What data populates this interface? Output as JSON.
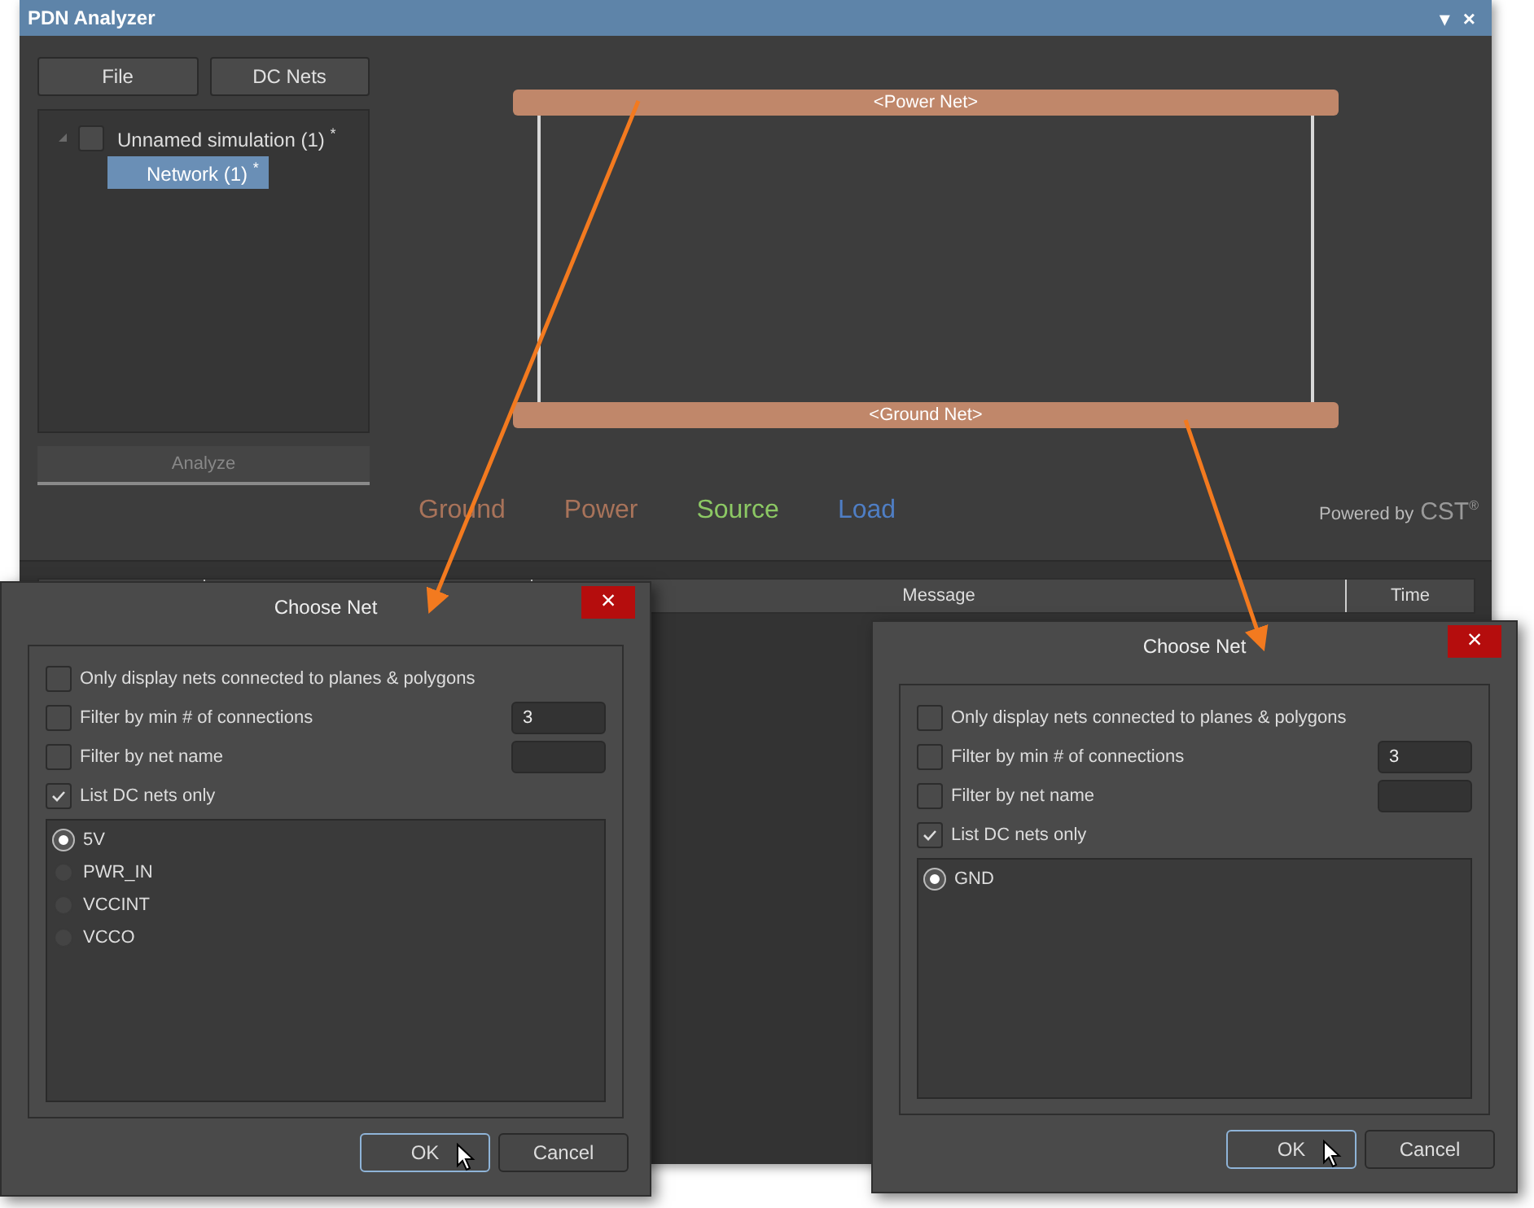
{
  "window": {
    "title": "PDN Analyzer",
    "menu_glyph": "▾",
    "close_glyph": "×"
  },
  "toolbar_buttons": [
    "File",
    "DC Nets"
  ],
  "tree": [
    {
      "label": "Unnamed simulation (1) $^{*}$",
      "checked": false,
      "expanded": true,
      "selected": false,
      "children": [
        {
          "label": "Network (1) $^{*}$",
          "selected": true
        }
      ]
    }
  ],
  "analyze_button": {
    "label": "Analyze",
    "disabled": true
  },
  "diagram": {
    "power_net": "<Power Net>",
    "ground_net": "<Ground Net>"
  },
  "legend": [
    {
      "label": "Ground",
      "color": "#a8735a"
    },
    {
      "label": "Power",
      "color": "#a8735a"
    },
    {
      "label": "Source",
      "color": "#8cc864"
    },
    {
      "label": "Load",
      "color": "#4f7ec4"
    }
  ],
  "brand": {
    "prefix": "Powered by",
    "name": "CST",
    "mark": "®"
  },
  "messages_table": {
    "columns": [
      "Message",
      "Time"
    ]
  },
  "dialogs": [
    {
      "title": "Choose Net",
      "close": "×",
      "options": [
        {
          "label": "Only display nets connected to planes & polygons",
          "checked": false,
          "kind": "plain"
        },
        {
          "label": "Filter by min # of connections",
          "checked": false,
          "kind": "field",
          "value": "3"
        },
        {
          "label": "Filter by net name",
          "checked": false,
          "kind": "field"
        },
        {
          "label": "List DC nets only",
          "checked": true,
          "kind": "plain"
        }
      ],
      "nets": [
        {
          "label": "5V",
          "selected": true
        },
        {
          "label": "PWR_IN",
          "selected": false
        },
        {
          "label": "VCCINT",
          "selected": false
        },
        {
          "label": "VCCO",
          "selected": false
        }
      ],
      "buttons": [
        {
          "label": "OK",
          "focused": true,
          "cursor": true
        },
        {
          "label": "Cancel",
          "focused": false,
          "cursor": false
        }
      ]
    },
    {
      "title": "Choose Net",
      "close": "×",
      "options": [
        {
          "label": "Only display nets connected to planes & polygons",
          "checked": false,
          "kind": "plain"
        },
        {
          "label": "Filter by min # of connections",
          "checked": false,
          "kind": "field",
          "value": "3"
        },
        {
          "label": "Filter by net name",
          "checked": false,
          "kind": "field"
        },
        {
          "label": "List DC nets only",
          "checked": true,
          "kind": "plain"
        }
      ],
      "nets": [
        {
          "label": "GND",
          "selected": true
        }
      ],
      "buttons": [
        {
          "label": "OK",
          "focused": true,
          "cursor": true
        },
        {
          "label": "Cancel",
          "focused": false,
          "cursor": false
        }
      ]
    }
  ]
}
